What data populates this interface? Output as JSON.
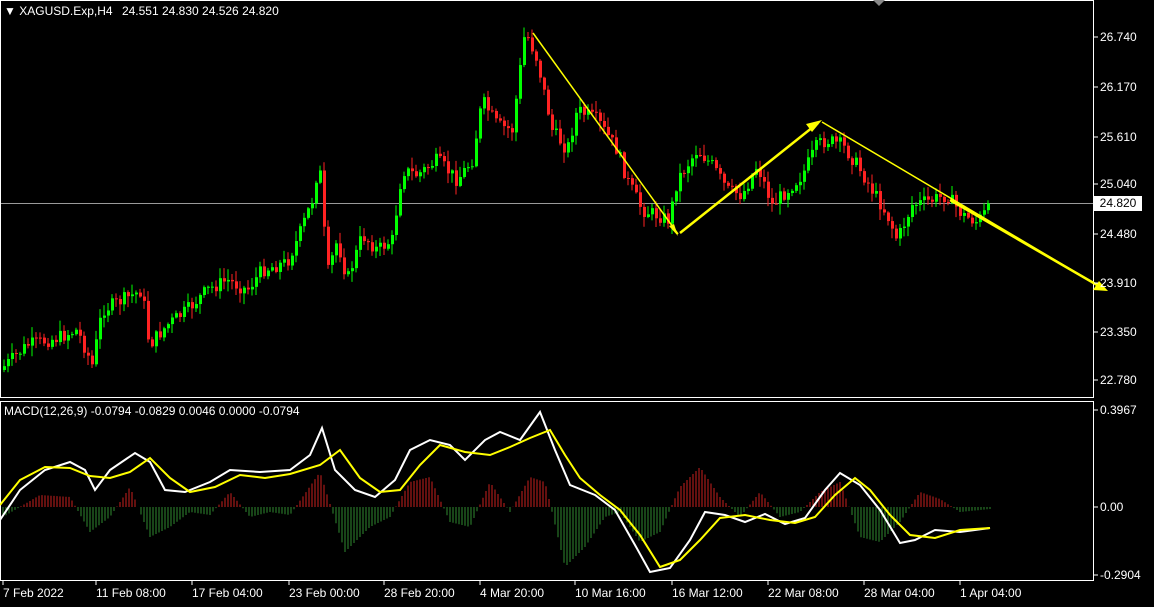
{
  "main_chart": {
    "symbol_header": "XAGUSD.Exp,H4",
    "ohlc_header": "24.551 24.830 24.526 24.820",
    "current_price_label": "24.820",
    "y_ticks": [
      "26.740",
      "26.170",
      "25.610",
      "25.040",
      "24.480",
      "23.910",
      "23.350",
      "22.780"
    ],
    "y_tick_values": [
      26.74,
      26.17,
      25.61,
      25.04,
      24.48,
      23.91,
      23.35,
      22.78
    ]
  },
  "indicator": {
    "header": "MACD(12,26,9) -0.0794 -0.0829 0.0046 0.0000 -0.0794",
    "y_ticks": [
      "0.3967",
      "0.00",
      "-0.2904"
    ]
  },
  "time_axis": {
    "labels": [
      "7 Feb 2022",
      "11 Feb 08:00",
      "17 Feb 04:00",
      "23 Feb 00:00",
      "28 Feb 20:00",
      "4 Mar 20:00",
      "10 Mar 16:00",
      "16 Mar 12:00",
      "22 Mar 08:00",
      "28 Mar 04:00",
      "1 Apr 04:00"
    ]
  },
  "colors": {
    "background": "#000000",
    "bull_candle": "#00ff00",
    "bear_candle": "#ff2222",
    "grid_axis": "#ffffff",
    "arrow": "#ffff00",
    "macd_line": "#ffffff",
    "signal_line": "#ffff00",
    "hist_positive": "#c8201e",
    "hist_negative": "#2f8a2f"
  }
}
